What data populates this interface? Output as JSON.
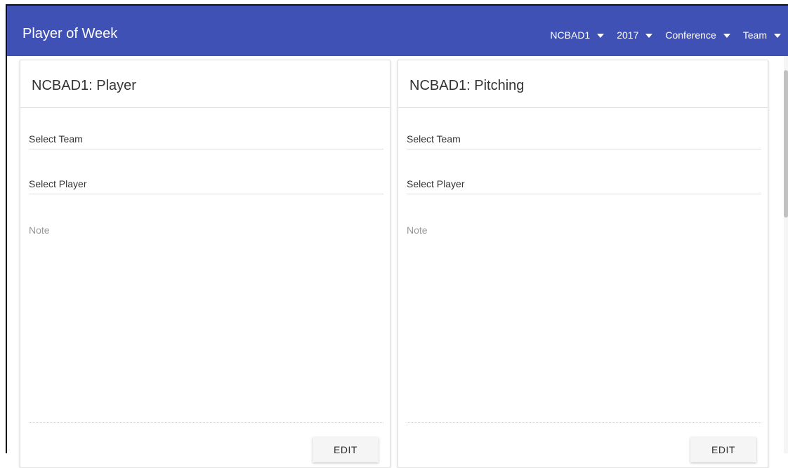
{
  "header": {
    "title": "Player of Week",
    "filters": [
      {
        "label": "NCBAD1"
      },
      {
        "label": "2017"
      },
      {
        "label": "Conference"
      },
      {
        "label": "Team"
      }
    ],
    "color": "#3f51b5"
  },
  "cards": [
    {
      "title": "NCBAD1: Player",
      "team_select": "Select Team",
      "player_select": "Select Player",
      "note_placeholder": "Note",
      "edit_label": "EDIT"
    },
    {
      "title": "NCBAD1: Pitching",
      "team_select": "Select Team",
      "player_select": "Select Player",
      "note_placeholder": "Note",
      "edit_label": "EDIT"
    }
  ]
}
